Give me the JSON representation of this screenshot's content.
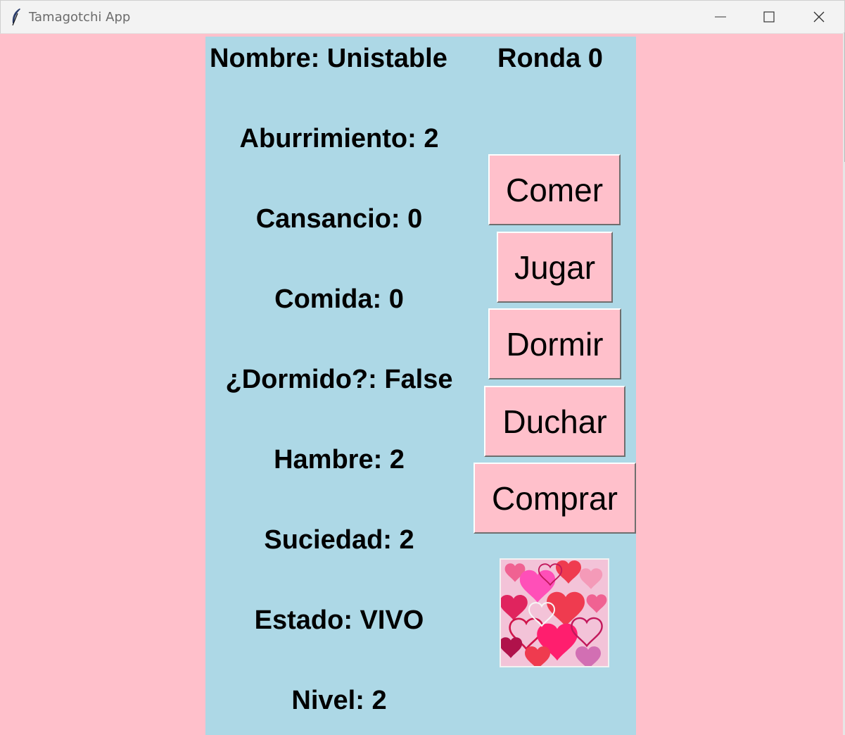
{
  "window": {
    "title": "Tamagotchi App",
    "app_icon": "feather-icon"
  },
  "stats": {
    "nombre": "Nombre: Unistable",
    "ronda": "Ronda 0",
    "aburrimiento": "Aburrimiento: 2",
    "cansancio": "Cansancio: 0",
    "comida": "Comida: 0",
    "dormido": "¿Dormido?: False",
    "hambre": "Hambre: 2",
    "suciedad": "Suciedad: 2",
    "estado": "Estado: VIVO",
    "nivel": "Nivel: 2"
  },
  "actions": {
    "comer": "Comer",
    "jugar": "Jugar",
    "dormir": "Dormir",
    "duchar": "Duchar",
    "comprar": "Comprar"
  },
  "image": {
    "name": "hearts-pattern-image"
  },
  "colors": {
    "background": "#ffc0cb",
    "panel": "#add8e6",
    "button": "#ffc0cb"
  }
}
